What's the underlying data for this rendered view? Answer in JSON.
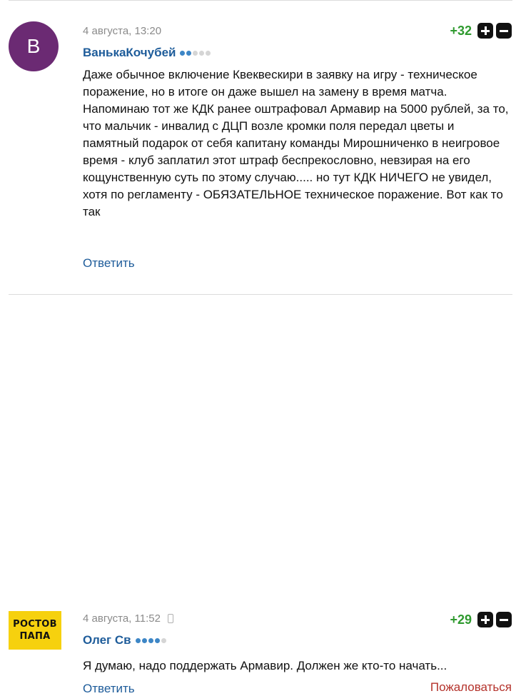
{
  "comments": [
    {
      "avatar_letter": "B",
      "date": "4 августа, 13:20",
      "author": "ВанькаКочубей",
      "rating": "+32",
      "text": "Даже обычное включение Квеквескири в заявку на игру - техническое поражение, но в итоге он даже вышел на замену в время матча. Напоминаю тот же КДК ранее оштрафовал Армавир на 5000 рублей, за то, что мальчик - инвалид с ДЦП возле кромки поля передал цветы и памятный подарок от себя капитану команды Мирошниченко в неигровое время - клуб заплатил этот штраф беспрекословно, невзирая на его кощунственную суть по этому случаю..... но тут КДК НИЧЕГО не увидел, хотя по регламенту - ОБЯЗАТЕЛЬНОЕ техническое поражение. Вот как то так",
      "reply_label": "Ответить",
      "avatar_color": "#6b2a73",
      "reputation_dots": {
        "filled": 2,
        "total": 5
      }
    },
    {
      "avatar_text_line1": "РОСТОВ",
      "avatar_text_line2": "ПАПА",
      "date": "4 августа, 11:52",
      "device_icon": "mobile-phone-icon",
      "author": "Олег Св",
      "rating": "+29",
      "text": "Я думаю, надо поддержать Армавир. Должен же кто-то начать...",
      "reply_label": "Ответить",
      "complain_label": "Пожаловаться",
      "avatar_color": "#f6d10e",
      "reputation_dots": {
        "filled": 4,
        "total": 5
      }
    }
  ],
  "colors": {
    "author": "#1e5c9a",
    "rating_positive": "#2f9a2f",
    "complain": "#b4322b",
    "date": "#8a8a8a"
  },
  "icons": {
    "upvote": "plus-icon",
    "downvote": "minus-icon"
  }
}
